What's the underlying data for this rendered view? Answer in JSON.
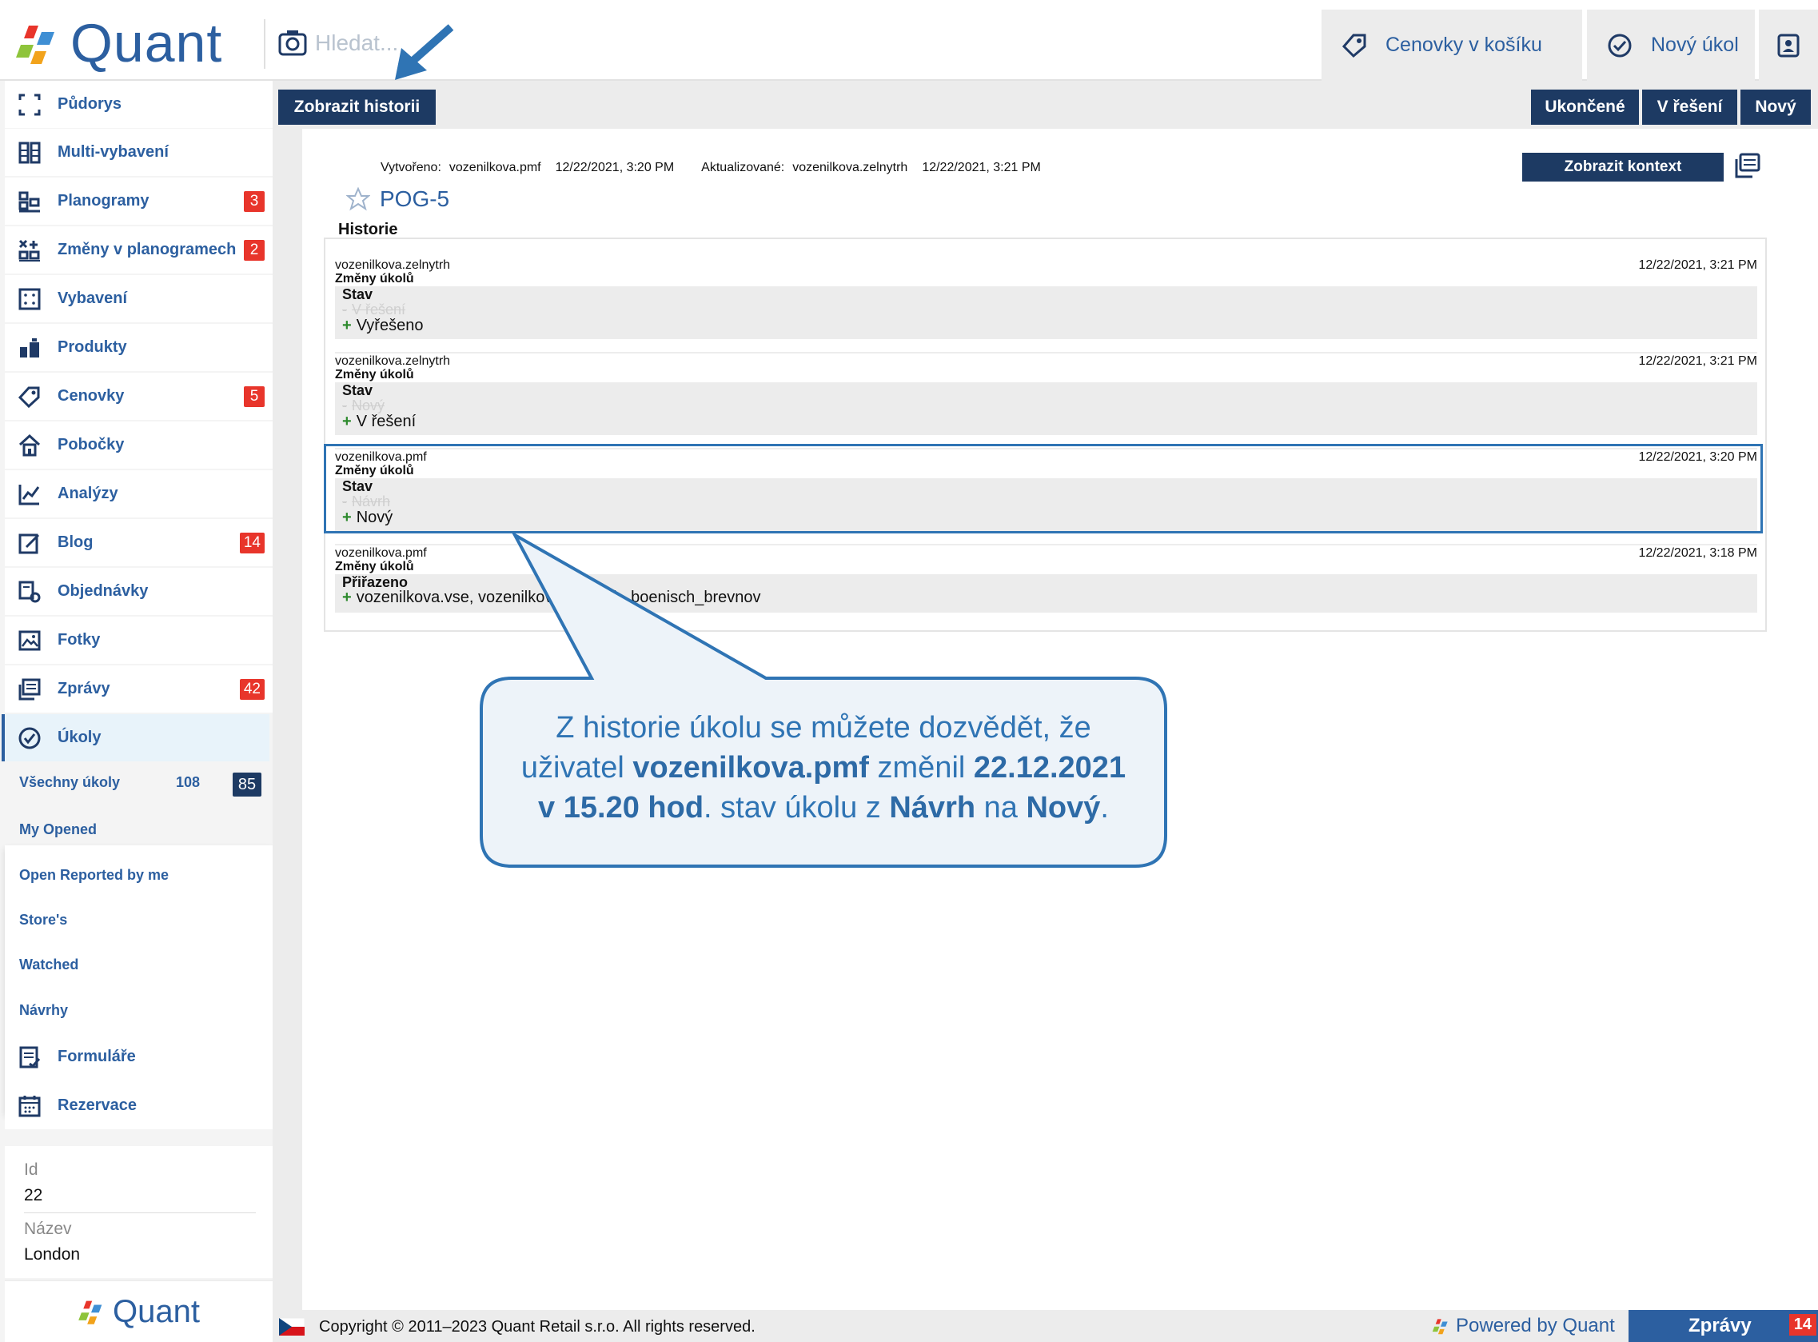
{
  "app": {
    "logo_text": "Quant"
  },
  "search": {
    "placeholder": "Hledat..."
  },
  "top_actions": {
    "cart_label": "Cenovky v košíku",
    "new_task_label": "Nový úkol"
  },
  "sidebar": {
    "items": [
      {
        "label": "Půdorys",
        "icon": "floorplan-icon",
        "badge": ""
      },
      {
        "label": "Multi-vybavení",
        "icon": "shelves-icon",
        "badge": ""
      },
      {
        "label": "Planogramy",
        "icon": "planogram-icon",
        "badge": "3"
      },
      {
        "label": "Změny v planogramech",
        "icon": "planogram-change-icon",
        "badge": "2"
      },
      {
        "label": "Vybavení",
        "icon": "equipment-icon",
        "badge": ""
      },
      {
        "label": "Produkty",
        "icon": "products-icon",
        "badge": ""
      },
      {
        "label": "Cenovky",
        "icon": "price-tag-icon",
        "badge": "5"
      },
      {
        "label": "Pobočky",
        "icon": "store-icon",
        "badge": ""
      },
      {
        "label": "Analýzy",
        "icon": "analytics-icon",
        "badge": ""
      },
      {
        "label": "Blog",
        "icon": "blog-icon",
        "badge": "14"
      },
      {
        "label": "Objednávky",
        "icon": "orders-icon",
        "badge": ""
      },
      {
        "label": "Fotky",
        "icon": "photo-icon",
        "badge": ""
      },
      {
        "label": "Zprávy",
        "icon": "messages-icon",
        "badge": "42"
      },
      {
        "label": "Úkoly",
        "icon": "tasks-icon",
        "badge": ""
      }
    ],
    "sub_items": [
      {
        "label": "Všechny úkoly",
        "count": "108",
        "badge": "85"
      },
      {
        "label": "My Opened"
      },
      {
        "label": "Open Reported by me"
      },
      {
        "label": "Store's"
      },
      {
        "label": "Watched"
      },
      {
        "label": "Návrhy"
      }
    ],
    "bottom_items": [
      {
        "label": "Formuláře",
        "icon": "forms-icon"
      },
      {
        "label": "Rezervace",
        "icon": "calendar-icon"
      }
    ],
    "props": [
      {
        "label": "Id",
        "value": "22"
      },
      {
        "label": "Název",
        "value": "London"
      }
    ],
    "footer_logo_text": "Quant"
  },
  "toolbar": {
    "history_button": "Zobrazit historii",
    "status_buttons": [
      "Ukončené",
      "V řešení",
      "Nový"
    ]
  },
  "task": {
    "created_label": "Vytvořeno:",
    "created_by": "vozenilkova.pmf",
    "created_at": "12/22/2021, 3:20 PM",
    "updated_label": "Aktualizované:",
    "updated_by": "vozenilkova.zelnytrh",
    "updated_at": "12/22/2021, 3:21 PM",
    "id": "POG-5",
    "context_button": "Zobrazit kontext",
    "history_title": "Historie"
  },
  "history": [
    {
      "user": "vozenilkova.zelnytrh",
      "date": "12/22/2021, 3:21 PM",
      "kind": "Změny úkolů",
      "field": "Stav",
      "old": "V řešení",
      "new": "Vyřešeno"
    },
    {
      "user": "vozenilkova.zelnytrh",
      "date": "12/22/2021, 3:21 PM",
      "kind": "Změny úkolů",
      "field": "Stav",
      "old": "Nový",
      "new": "V řešení"
    },
    {
      "user": "vozenilkova.pmf",
      "date": "12/22/2021, 3:20 PM",
      "kind": "Změny úkolů",
      "field": "Stav",
      "old": "Návrh",
      "new": "Nový"
    },
    {
      "user": "vozenilkova.pmf",
      "date": "12/22/2021, 3:18 PM",
      "kind": "Změny úkolů",
      "field": "Přiřazeno",
      "old": "",
      "new": "vozenilkova.vse, vozenilkova.zelnytrh, boenisch_brevnov"
    }
  ],
  "callout": {
    "t1": "Z historie úkolu se můžete dozvědět, že",
    "t2": "uživatel ",
    "t3": "vozenilkova.pmf",
    "t4": " změnil ",
    "t5": "22.12.2021",
    "t6": "v 15.20 hod",
    "t7": ". stav úkolu z ",
    "t8": "Návrh",
    "t9": " na ",
    "t10": "Nový",
    "t11": "."
  },
  "footer": {
    "copyright": "Copyright © 2011–2023 Quant Retail s.r.o. All rights reserved.",
    "powered": "Powered by Quant",
    "messages_tab": "Zprávy",
    "messages_badge": "14"
  },
  "colors": {
    "brand_blue": "#2c5fa0",
    "dark_navy": "#1d3a63",
    "badge_red": "#e8352b",
    "highlight": "#2f74b4"
  }
}
